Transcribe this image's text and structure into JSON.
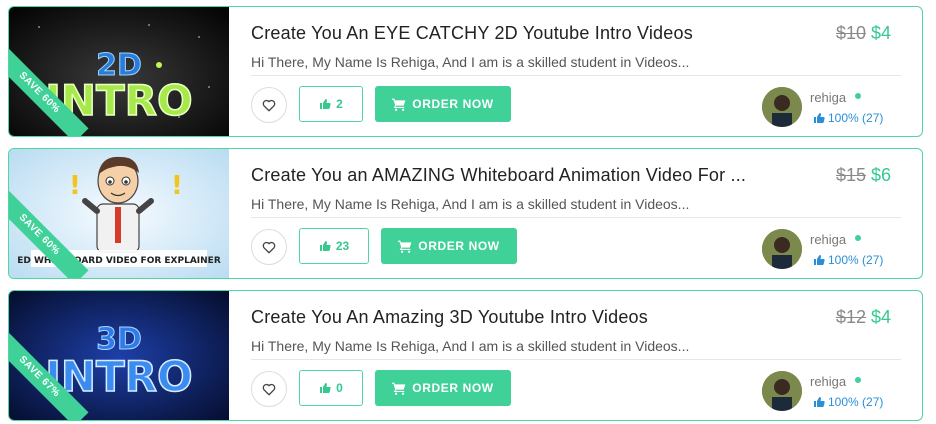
{
  "colors": {
    "accent": "#3fd198",
    "border": "#4fd6a3",
    "old_price": "#8a8a8a",
    "rating": "#2a8fd8"
  },
  "icons": {
    "heart": "heart-icon",
    "thumb": "thumbs-up-icon",
    "cart": "cart-icon"
  },
  "gigs": [
    {
      "thumbnail_text": "2D INTRO",
      "ribbon": "SAVE 60%",
      "title": "Create You An EYE CATCHY 2D Youtube Intro Videos",
      "old_price": "$10",
      "new_price": "$4",
      "description": "Hi There, My Name Is Rehiga, And I am is a skilled student in Videos...",
      "likes": "2",
      "order_label": "ORDER NOW",
      "seller": "rehiga",
      "rating": "100% (27)"
    },
    {
      "thumbnail_text": "ED WHITEBOARD VIDEO FOR EXPLAINER",
      "ribbon": "SAVE 60%",
      "title": "Create You an AMAZING Whiteboard Animation Video For ...",
      "old_price": "$15",
      "new_price": "$6",
      "description": "Hi There, My Name Is Rehiga, And I am is a skilled student in Videos...",
      "likes": "23",
      "order_label": "ORDER NOW",
      "seller": "rehiga",
      "rating": "100% (27)"
    },
    {
      "thumbnail_text": "3D INTRO",
      "ribbon": "SAVE 67%",
      "title": "Create You An Amazing 3D Youtube Intro Videos",
      "old_price": "$12",
      "new_price": "$4",
      "description": "Hi There, My Name Is Rehiga, And I am is a skilled student in Videos...",
      "likes": "0",
      "order_label": "ORDER NOW",
      "seller": "rehiga",
      "rating": "100% (27)"
    }
  ]
}
